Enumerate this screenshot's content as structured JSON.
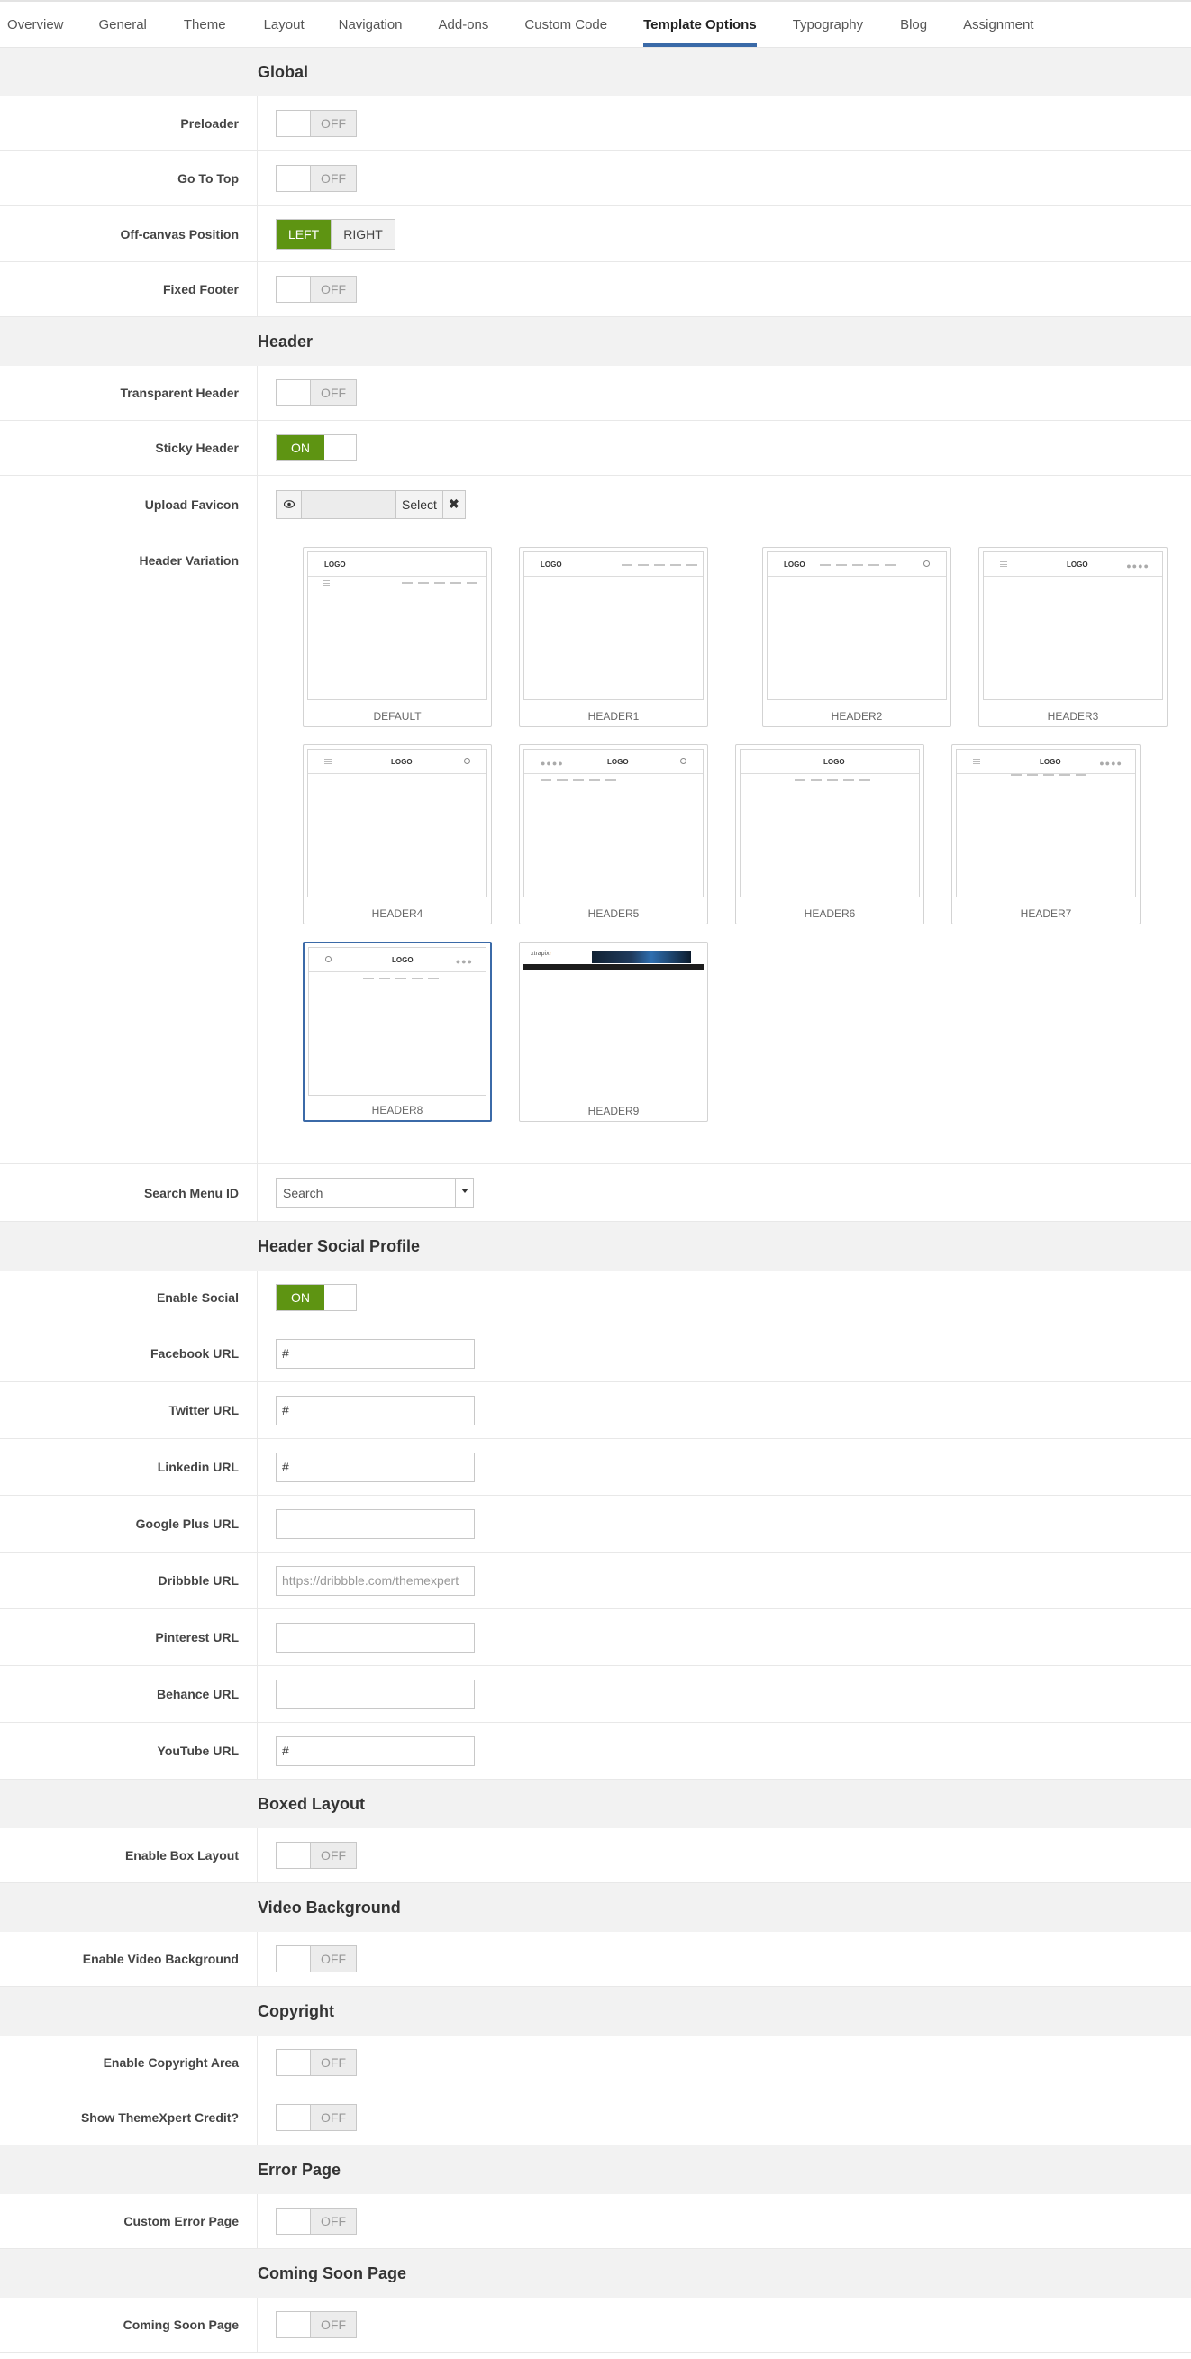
{
  "tabs": [
    "Overview",
    "General",
    "Theme",
    "Layout",
    "Navigation",
    "Add-ons",
    "Custom Code",
    "Template Options",
    "Typography",
    "Blog",
    "Assignment"
  ],
  "active_tab": "Template Options",
  "toggle": {
    "off": "OFF",
    "on": "ON"
  },
  "sections": {
    "global": "Global",
    "header": "Header",
    "social": "Header Social Profile",
    "boxed": "Boxed Layout",
    "video": "Video Background",
    "copyright": "Copyright",
    "error": "Error Page",
    "coming": "Coming Soon Page"
  },
  "fields": {
    "preloader": {
      "label": "Preloader",
      "state": "OFF"
    },
    "go_top": {
      "label": "Go To Top",
      "state": "OFF"
    },
    "offcanvas": {
      "label": "Off-canvas Position",
      "left": "LEFT",
      "right": "RIGHT",
      "selected": "LEFT"
    },
    "fixed_footer": {
      "label": "Fixed Footer",
      "state": "OFF"
    },
    "transparent_header": {
      "label": "Transparent Header",
      "state": "OFF"
    },
    "sticky_header": {
      "label": "Sticky Header",
      "state": "ON"
    },
    "favicon": {
      "label": "Upload Favicon",
      "select": "Select",
      "clear": "✖"
    },
    "header_variation": {
      "label": "Header Variation",
      "selected": "HEADER8"
    },
    "search_menu": {
      "label": "Search Menu ID",
      "value": "Search"
    },
    "enable_social": {
      "label": "Enable Social",
      "state": "ON"
    },
    "facebook": {
      "label": "Facebook URL",
      "value": "#"
    },
    "twitter": {
      "label": "Twitter URL",
      "value": "#"
    },
    "linkedin": {
      "label": "Linkedin URL",
      "value": "#"
    },
    "googleplus": {
      "label": "Google Plus URL",
      "value": ""
    },
    "dribbble": {
      "label": "Dribbble URL",
      "value": "",
      "placeholder": "https://dribbble.com/themexpert"
    },
    "pinterest": {
      "label": "Pinterest URL",
      "value": ""
    },
    "behance": {
      "label": "Behance URL",
      "value": ""
    },
    "youtube": {
      "label": "YouTube URL",
      "value": "#"
    },
    "box_layout": {
      "label": "Enable Box Layout",
      "state": "OFF"
    },
    "video_bg": {
      "label": "Enable Video Background",
      "state": "OFF"
    },
    "copyright_area": {
      "label": "Enable Copyright Area",
      "state": "OFF"
    },
    "tx_credit": {
      "label": "Show ThemeXpert Credit?",
      "state": "OFF"
    },
    "error_page": {
      "label": "Custom Error Page",
      "state": "OFF"
    },
    "coming_soon": {
      "label": "Coming Soon Page",
      "state": "OFF"
    }
  },
  "header_variants": [
    "DEFAULT",
    "HEADER1",
    "HEADER2",
    "HEADER3",
    "HEADER4",
    "HEADER5",
    "HEADER6",
    "HEADER7",
    "HEADER8",
    "HEADER9"
  ],
  "thumb_logo": "LOGO",
  "thumb_brand": {
    "a": "xtrapix",
    "b": "r"
  },
  "colors": {
    "accent_green": "#5e9412",
    "tab_underline": "#3a6aa8",
    "section_bg": "#f2f2f2"
  },
  "icons": {
    "eye": "eye-icon",
    "caret": "caret-down-icon",
    "clear": "times-icon",
    "search": "search-icon",
    "menu": "hamburger-icon"
  }
}
